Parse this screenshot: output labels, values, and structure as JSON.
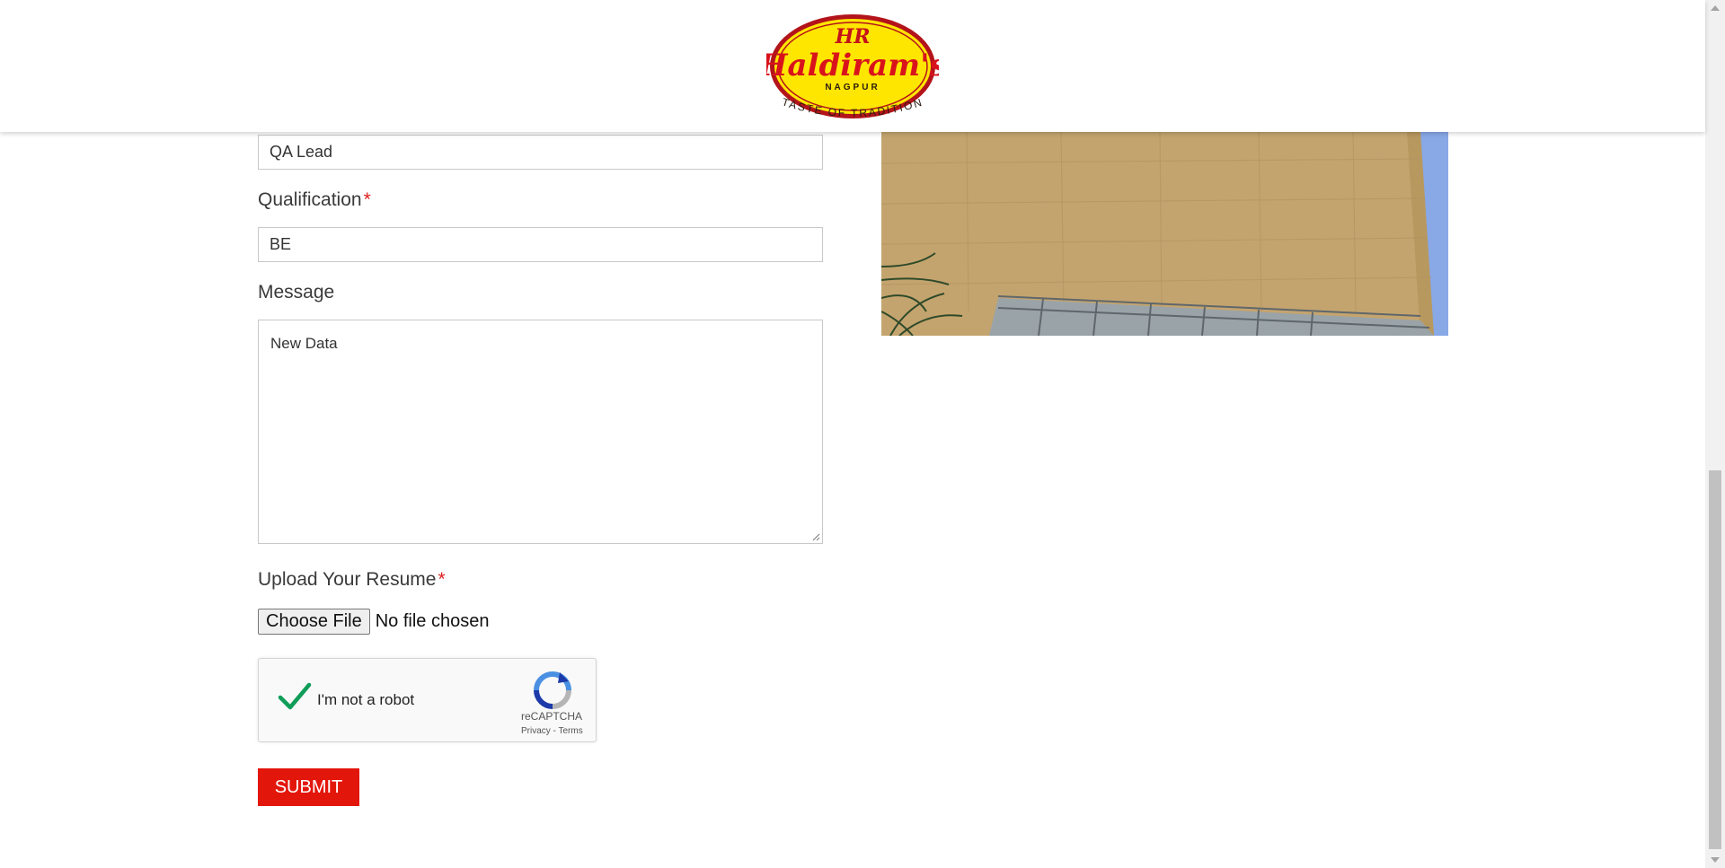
{
  "brand": {
    "name": "Haldiram's",
    "monogram": "HR",
    "city": "NAGPUR",
    "tagline": "TASTE OF TRADITION"
  },
  "form": {
    "position_value": "QA Lead",
    "qualification": {
      "label": "Qualification",
      "required": "*",
      "value": "BE"
    },
    "message": {
      "label": "Message",
      "value": "New Data"
    },
    "resume": {
      "label": "Upload Your Resume",
      "required": "*",
      "button": "Choose File",
      "status": "No file chosen"
    },
    "captcha": {
      "label": "I'm not a robot",
      "brand": "reCAPTCHA",
      "links": "Privacy - Terms",
      "checked": true
    },
    "submit_label": "SUBMIT"
  },
  "colors": {
    "accent": "#e3160b",
    "logo_yellow": "#ffe600",
    "logo_red": "#d8131c",
    "check_green": "#0f9d58"
  }
}
